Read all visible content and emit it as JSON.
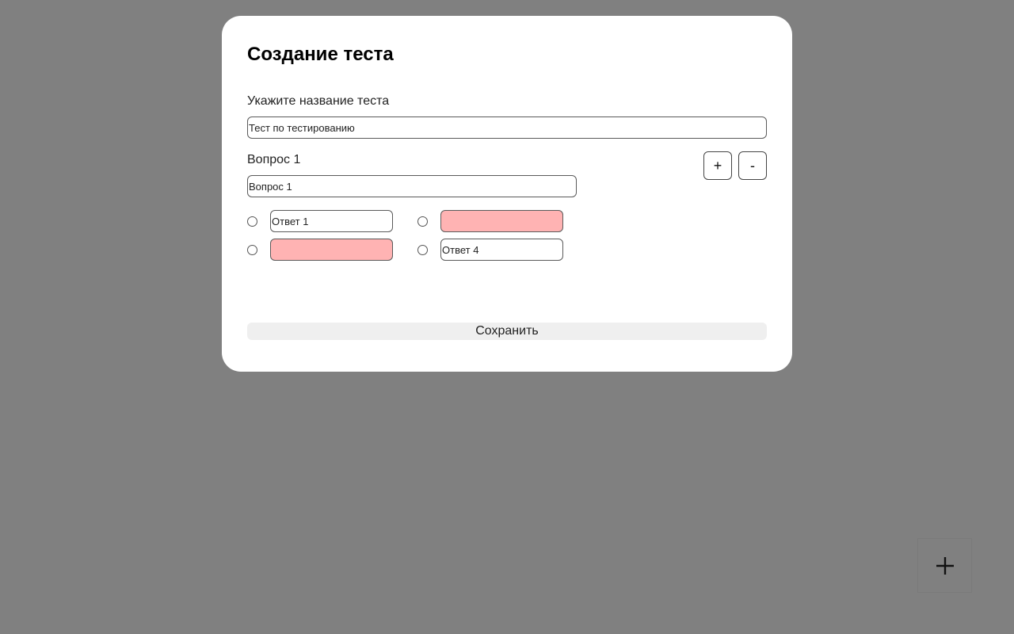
{
  "modal": {
    "title": "Создание теста",
    "test_name_label": "Укажите название теста",
    "test_name_value": "Тест по тестированию",
    "question_label": "Вопрос 1",
    "question_value": "Вопрос 1",
    "add_question_label": "+",
    "remove_question_label": "-",
    "answers": [
      {
        "value": "Ответ 1",
        "selected": false
      },
      {
        "value": "",
        "selected": false
      },
      {
        "value": "",
        "selected": false
      },
      {
        "value": "Ответ 4",
        "selected": false
      }
    ],
    "save_label": "Сохранить",
    "empty_field_color": "#ffb3b3"
  },
  "fab": {
    "icon": "plus-icon"
  },
  "colors": {
    "backdrop": "#808080",
    "modal_background": "#ffffff"
  }
}
